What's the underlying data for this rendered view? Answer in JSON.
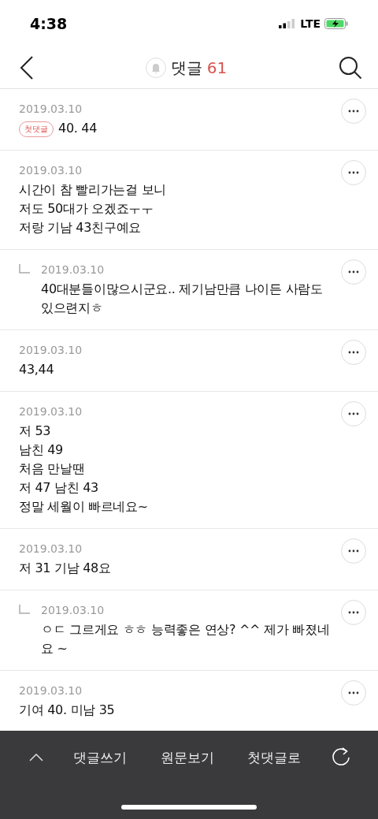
{
  "status_bar": {
    "time": "4:38",
    "network": "LTE"
  },
  "header": {
    "title": "댓글",
    "count": "61"
  },
  "comments": [
    {
      "kind": "comment",
      "date": "2019.03.10",
      "badge": "첫댓글",
      "lines": [
        "40. 44"
      ]
    },
    {
      "kind": "comment",
      "date": "2019.03.10",
      "lines": [
        "시간이 참 빨리가는걸 보니",
        "저도 50대가 오겠죠ㅜㅜ",
        "저랑 기남 43친구예요"
      ]
    },
    {
      "kind": "reply",
      "date": "2019.03.10",
      "lines": [
        "40대분들이많으시군요.. 제기남만큼 나이든 사람도 있으련지ㅎ"
      ]
    },
    {
      "kind": "comment",
      "date": "2019.03.10",
      "lines": [
        "43,44"
      ]
    },
    {
      "kind": "comment",
      "date": "2019.03.10",
      "lines": [
        "저 53",
        "남친 49",
        "처음 만날땐",
        "저 47 남친 43",
        "정말 세월이 빠르네요~"
      ]
    },
    {
      "kind": "comment",
      "date": "2019.03.10",
      "lines": [
        "저 31 기남 48요"
      ]
    },
    {
      "kind": "reply",
      "date": "2019.03.10",
      "lines": [
        "ㅇㄷ 그르게요 ㅎㅎ 능력좋은 연상? ^^ 제가 빠졌네요 ~"
      ]
    },
    {
      "kind": "comment",
      "date": "2019.03.10",
      "lines": [
        "기여 40. 미남 35"
      ]
    }
  ],
  "toolbar": {
    "buttons": [
      "댓글쓰기",
      "원문보기",
      "첫댓글로"
    ]
  }
}
